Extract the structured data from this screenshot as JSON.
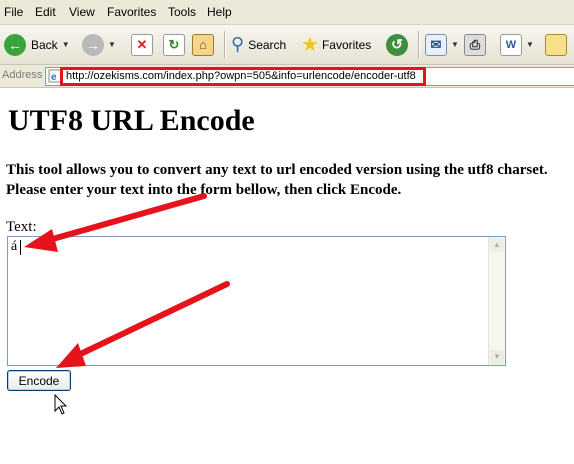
{
  "menu": [
    "File",
    "Edit",
    "View",
    "Favorites",
    "Tools",
    "Help"
  ],
  "toolbar": {
    "back_label": "Back",
    "search_label": "Search",
    "favorites_label": "Favorites"
  },
  "address": {
    "label": "Address",
    "url": "http://ozekisms.com/index.php?owpn=505&info=urlencode/encoder-utf8"
  },
  "page": {
    "title": "UTF8 URL Encode",
    "description": "This tool allows you to convert any text to url encoded version using the utf8 charset. Please enter your text into the form bellow, then click Encode.",
    "text_label": "Text:",
    "text_value": "á",
    "encode_label": "Encode"
  },
  "colors": {
    "annotation": "#e5141c",
    "chrome": "#ECE9D8"
  }
}
